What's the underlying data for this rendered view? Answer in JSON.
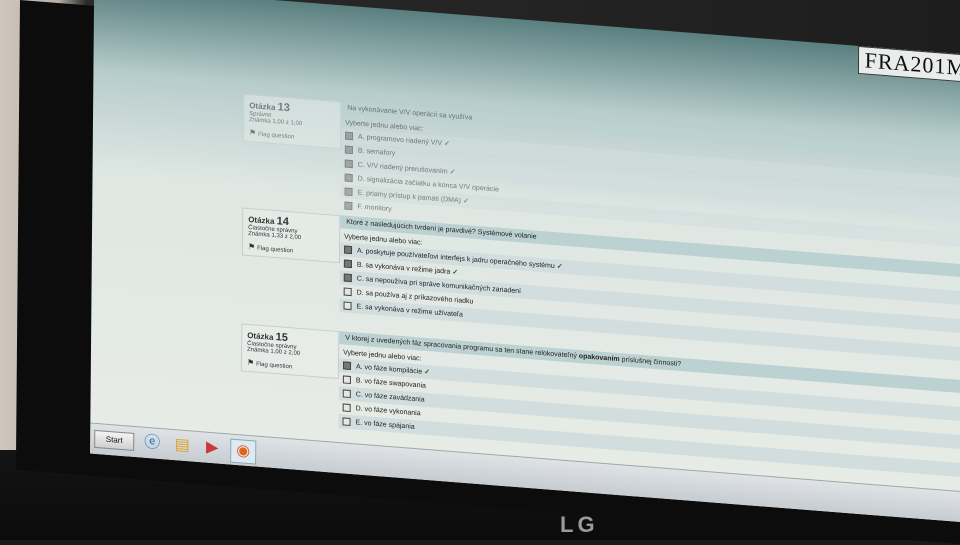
{
  "corner_tag": "FRA201M",
  "q13": {
    "number_label": "Otázka",
    "number": "13",
    "status": "Správne",
    "score": "Známka 1,00 z 1,00",
    "flag_label": "Flag question",
    "text": "Na vykonávanie V/V operácií sa využíva",
    "prompt": "Vyberte jednu alebo viac:",
    "options": [
      {
        "text": "A. programovo riadený V/V",
        "checked": true,
        "correct": true
      },
      {
        "text": "B. semafory",
        "checked": true,
        "correct": false
      },
      {
        "text": "C. V/V riadený prerušovaním",
        "checked": true,
        "correct": true
      },
      {
        "text": "D. signalizácia začiatku a konca V/V operácie",
        "checked": true,
        "correct": false
      },
      {
        "text": "E. priamy prístup k pamäti (DMA)",
        "checked": true,
        "correct": true
      },
      {
        "text": "F. monitory",
        "checked": true,
        "correct": false
      }
    ]
  },
  "q14": {
    "number_label": "Otázka",
    "number": "14",
    "status": "Čiastočne správny",
    "score": "Známka 1,33 z 2,00",
    "flag_label": "Flag question",
    "text": "Ktoré z nasledujúcich tvrdení je pravdivé? Systémové volanie",
    "prompt": "Vyberte jednu alebo viac:",
    "options": [
      {
        "text": "A. poskytuje používateľovi interfejs k jadru operačného systému",
        "checked": true,
        "correct": true
      },
      {
        "text": "B. sa vykonáva v režime jadra",
        "checked": true,
        "correct": true
      },
      {
        "text": "C. sa nepoužíva pri správe komunikačných zariadení",
        "checked": true,
        "correct": false
      },
      {
        "text": "D. sa používa aj z príkazového riadku",
        "checked": false,
        "correct": false
      },
      {
        "text": "E. sa vykonáva v režime užívateľa",
        "checked": false,
        "correct": false
      }
    ]
  },
  "q15": {
    "number_label": "Otázka",
    "number": "15",
    "status": "Čiastočne správny",
    "score": "Známka 1,00 z 2,00",
    "flag_label": "Flag question",
    "text_before": "V ktorej z uvedených fáz spracovania programu sa ten stane relokovateľný ",
    "text_bold": "opakovaním",
    "text_after": " príslušnej činnosti?",
    "prompt": "Vyberte jednu alebo viac:",
    "options": [
      {
        "text": "A. vo fáze kompilácie",
        "checked": true,
        "correct": true
      },
      {
        "text": "B. vo fáze swapovania",
        "checked": false,
        "correct": false
      },
      {
        "text": "C. vo fáze zavádzania",
        "checked": false,
        "correct": false
      },
      {
        "text": "D. vo fáze vykonania",
        "checked": false,
        "correct": false
      },
      {
        "text": "E. vo fáze spájania",
        "checked": false,
        "correct": false
      }
    ]
  },
  "taskbar": {
    "start_label": "Start",
    "icons": [
      "internet-explorer-icon",
      "file-explorer-icon",
      "media-player-icon",
      "firefox-icon"
    ]
  },
  "monitor_brand": "LG"
}
